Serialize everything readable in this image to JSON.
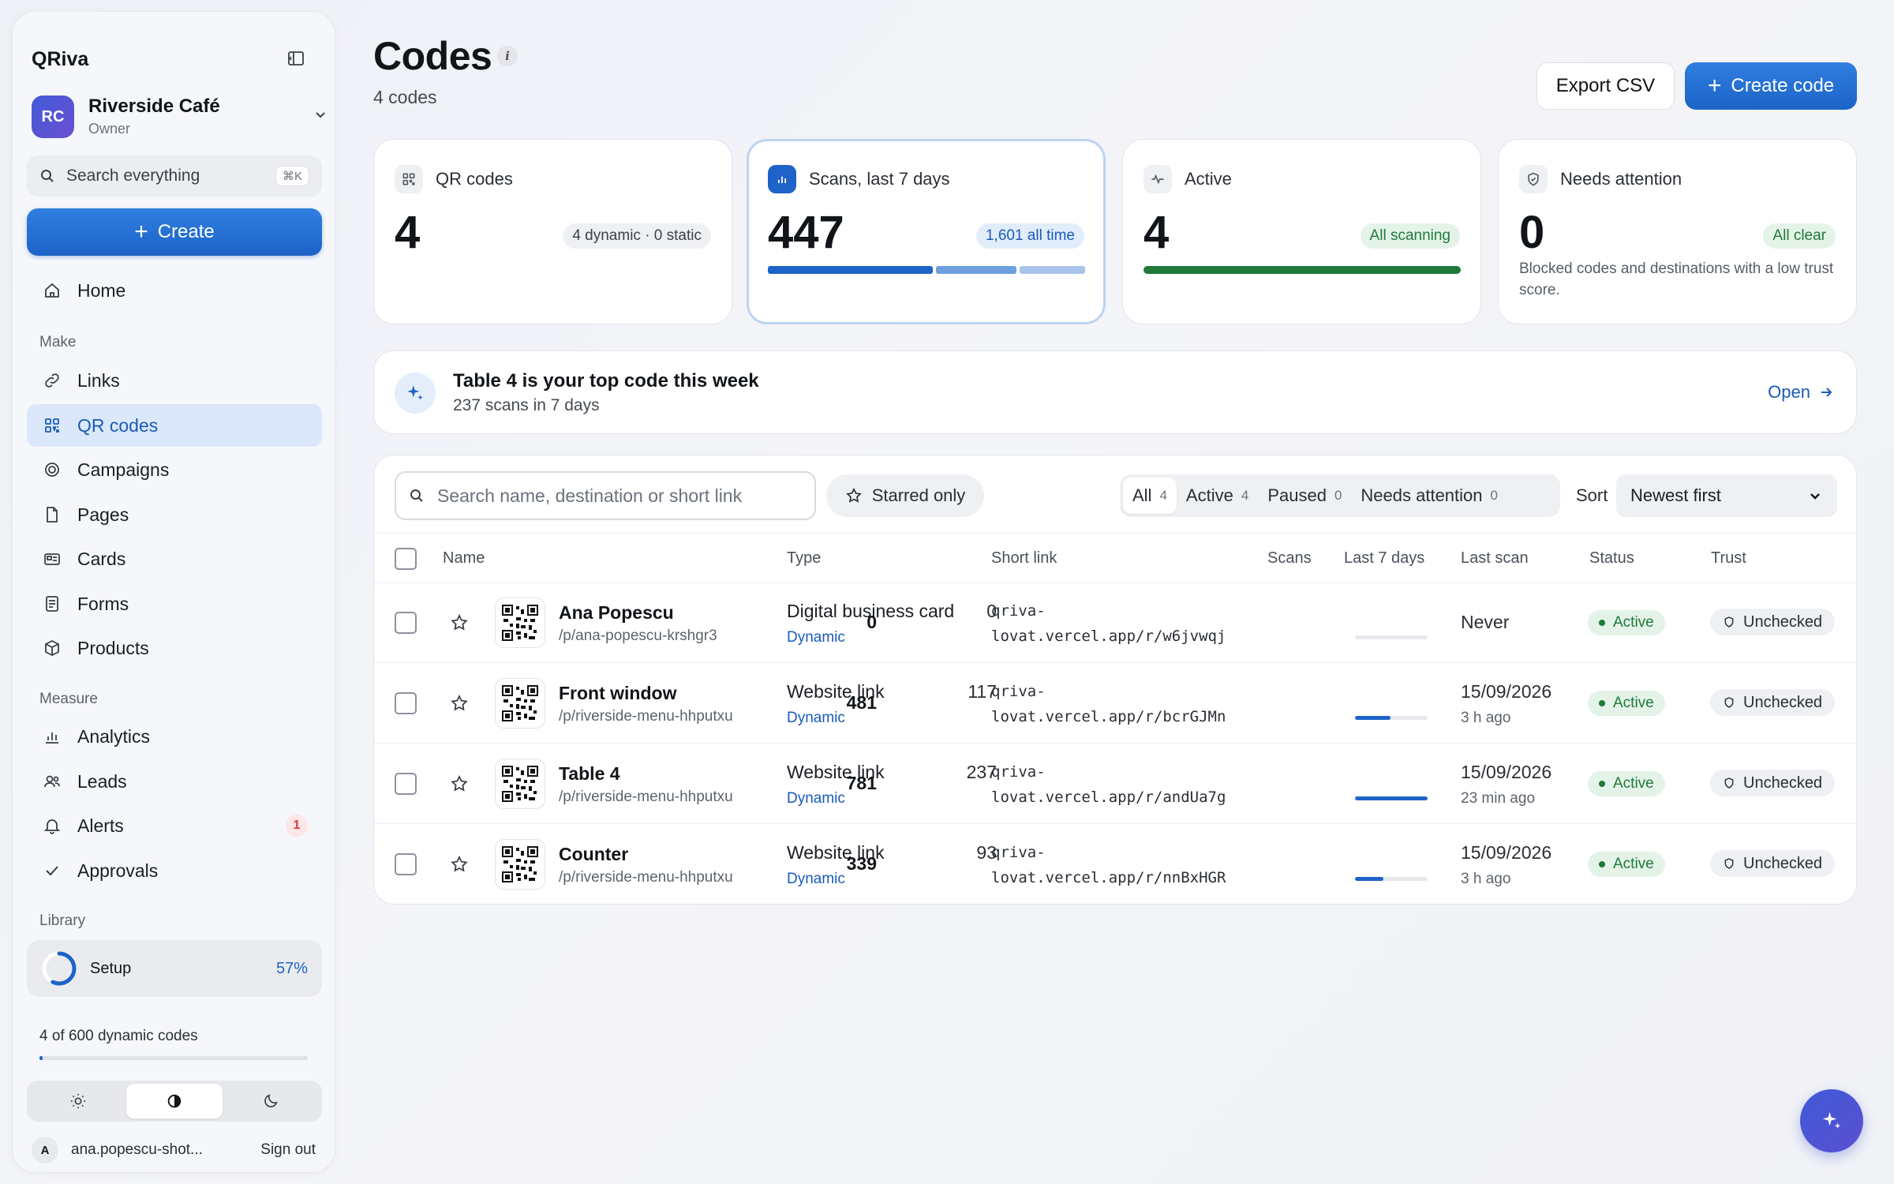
{
  "sidebar": {
    "brand": "QRiva",
    "workspace": {
      "initials": "RC",
      "name": "Riverside Café",
      "role": "Owner"
    },
    "search": {
      "label": "Search everything",
      "shortcut": "⌘K"
    },
    "create_label": "Create",
    "home_label": "Home",
    "sections": {
      "make": "Make",
      "measure": "Measure",
      "library": "Library"
    },
    "make_items": [
      {
        "label": "Links",
        "icon": "link-icon"
      },
      {
        "label": "QR codes",
        "icon": "qr-grid-icon",
        "active": true
      },
      {
        "label": "Campaigns",
        "icon": "target-icon"
      },
      {
        "label": "Pages",
        "icon": "page-icon"
      },
      {
        "label": "Cards",
        "icon": "card-icon"
      },
      {
        "label": "Forms",
        "icon": "form-icon"
      },
      {
        "label": "Products",
        "icon": "box-icon"
      }
    ],
    "measure_items": [
      {
        "label": "Analytics",
        "icon": "bar-chart-icon"
      },
      {
        "label": "Leads",
        "icon": "users-icon"
      },
      {
        "label": "Alerts",
        "icon": "bell-icon",
        "badge": "1"
      },
      {
        "label": "Approvals",
        "icon": "check-icon"
      }
    ],
    "setup": {
      "label": "Setup",
      "percent_text": "57%",
      "progress": 0.57
    },
    "quota": {
      "text": "4 of 600 dynamic codes",
      "used": 4,
      "total": 600
    },
    "theme": {
      "options": [
        "light",
        "system",
        "dark"
      ],
      "selected": "system"
    },
    "user": {
      "initial": "A",
      "email": "ana.popescu-shot...",
      "signout_label": "Sign out"
    }
  },
  "header": {
    "title": "Codes",
    "info_glyph": "i",
    "subtitle": "4 codes",
    "export_label": "Export CSV",
    "create_label": "Create code"
  },
  "stats": [
    {
      "label": "QR codes",
      "value": "4",
      "pill": "4 dynamic · 0 static",
      "icon": "qr-grid-icon"
    },
    {
      "label": "Scans, last 7 days",
      "value": "447",
      "pill": "1,601 all time",
      "icon": "bar-chart-icon",
      "bar_segments": [
        0.53,
        0.26,
        0.21
      ]
    },
    {
      "label": "Active",
      "value": "4",
      "pill": "All scanning",
      "icon": "pulse-icon",
      "progress": 1.0
    },
    {
      "label": "Needs attention",
      "value": "0",
      "pill": "All clear",
      "icon": "shield-icon",
      "description": "Blocked codes and destinations with a low trust score."
    }
  ],
  "top_code": {
    "title": "Table 4 is your top code this week",
    "subtitle": "237 scans in 7 days",
    "open_label": "Open"
  },
  "table": {
    "search_placeholder": "Search name, destination or short link",
    "starred_label": "Starred only",
    "filters": [
      {
        "label": "All",
        "count": "4",
        "selected": true
      },
      {
        "label": "Active",
        "count": "4"
      },
      {
        "label": "Paused",
        "count": "0"
      },
      {
        "label": "Needs attention",
        "count": "0"
      }
    ],
    "sort_label": "Sort",
    "sort_value": "Newest first",
    "columns": [
      "Name",
      "Type",
      "Short link",
      "Scans",
      "Last 7 days",
      "Last scan",
      "Status",
      "Trust"
    ],
    "rows": [
      {
        "name": "Ana Popescu",
        "path": "/p/ana-popescu-krshgr3",
        "type": "Digital business card",
        "mode": "Dynamic",
        "link1": "qriva-",
        "link2": "lovat.vercel.app/r/w6jvwqj",
        "scans": "0",
        "last7": "0",
        "last7_ratio": 0.0,
        "last_scan": "Never",
        "last_scan_sub": "",
        "status": "Active",
        "trust": "Unchecked"
      },
      {
        "name": "Front window",
        "path": "/p/riverside-menu-hhputxu",
        "type": "Website link",
        "mode": "Dynamic",
        "link1": "qriva-",
        "link2": "lovat.vercel.app/r/bcrGJMn",
        "scans": "481",
        "last7": "117",
        "last7_ratio": 0.49,
        "last_scan": "15/09/2026",
        "last_scan_sub": "3 h ago",
        "status": "Active",
        "trust": "Unchecked"
      },
      {
        "name": "Table 4",
        "path": "/p/riverside-menu-hhputxu",
        "type": "Website link",
        "mode": "Dynamic",
        "link1": "qriva-",
        "link2": "lovat.vercel.app/r/andUa7g",
        "scans": "781",
        "last7": "237",
        "last7_ratio": 1.0,
        "last_scan": "15/09/2026",
        "last_scan_sub": "23 min ago",
        "status": "Active",
        "trust": "Unchecked"
      },
      {
        "name": "Counter",
        "path": "/p/riverside-menu-hhputxu",
        "type": "Website link",
        "mode": "Dynamic",
        "link1": "qriva-",
        "link2": "lovat.vercel.app/r/nnBxHGR",
        "scans": "339",
        "last7": "93",
        "last7_ratio": 0.39,
        "last_scan": "15/09/2026",
        "last_scan_sub": "3 h ago",
        "status": "Active",
        "trust": "Unchecked"
      }
    ]
  },
  "colors": {
    "accent": "#1d63c8",
    "success": "#1f7a3a",
    "danger": "#d23a3a"
  }
}
